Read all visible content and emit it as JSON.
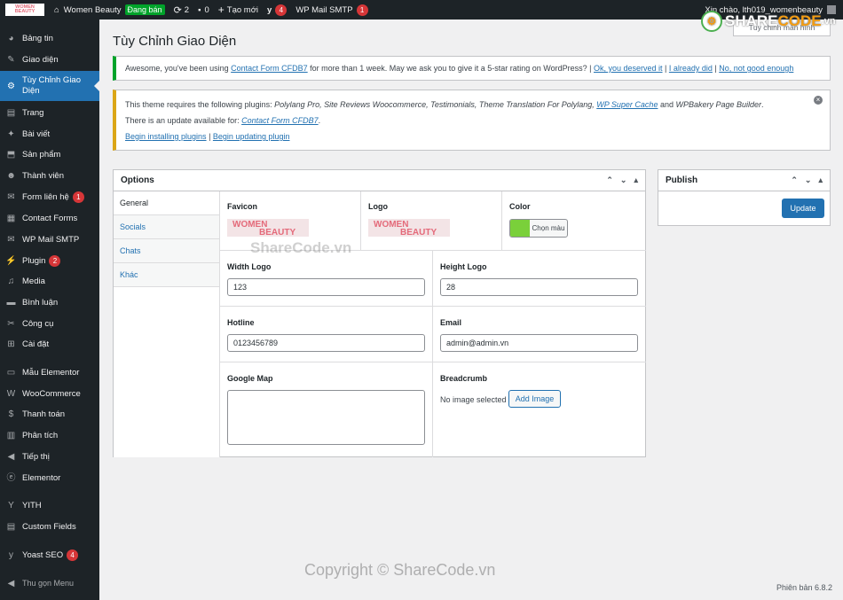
{
  "adminbar": {
    "logo_text": "WOMEN BEAUTY",
    "site_name": "Women Beauty",
    "status_badge": "Đang bán",
    "updates_count": "2",
    "comments_count": "0",
    "new_label": "Tạo mới",
    "yoast_count": "4",
    "smtp_label": "WP Mail SMTP",
    "smtp_count": "1",
    "greeting": "Xin chào, lth019_womenbeauty"
  },
  "sidebar": {
    "items": [
      {
        "label": "Bảng tin",
        "icon": "dashboard-icon"
      },
      {
        "label": "Giao diện",
        "icon": "appearance-icon"
      },
      {
        "label": "Tùy Chỉnh Giao Diện",
        "icon": "gear-icon"
      },
      {
        "label": "Trang",
        "icon": "pages-icon"
      },
      {
        "label": "Bài viết",
        "icon": "pin-icon"
      },
      {
        "label": "Sản phẩm",
        "icon": "products-icon"
      },
      {
        "label": "Thành viên",
        "icon": "users-icon"
      },
      {
        "label": "Form liên hệ",
        "icon": "mail-icon",
        "badge": "1"
      },
      {
        "label": "Contact Forms",
        "icon": "forms-icon"
      },
      {
        "label": "WP Mail SMTP",
        "icon": "smtp-icon"
      },
      {
        "label": "Plugin",
        "icon": "plugin-icon",
        "badge": "2"
      },
      {
        "label": "Media",
        "icon": "media-icon"
      },
      {
        "label": "Bình luận",
        "icon": "comment-icon"
      },
      {
        "label": "Công cụ",
        "icon": "tools-icon"
      },
      {
        "label": "Cài đặt",
        "icon": "settings-icon"
      },
      {
        "label": "Mẫu Elementor",
        "icon": "folder-icon"
      },
      {
        "label": "WooCommerce",
        "icon": "woo-icon"
      },
      {
        "label": "Thanh toán",
        "icon": "payment-icon"
      },
      {
        "label": "Phân tích",
        "icon": "analytics-icon"
      },
      {
        "label": "Tiếp thị",
        "icon": "megaphone-icon"
      },
      {
        "label": "Elementor",
        "icon": "elementor-icon"
      },
      {
        "label": "YITH",
        "icon": "yith-icon"
      },
      {
        "label": "Custom Fields",
        "icon": "fields-icon"
      },
      {
        "label": "Yoast SEO",
        "icon": "yoast-icon",
        "badge": "4"
      },
      {
        "label": "Thu gọn Menu",
        "icon": "collapse-icon"
      }
    ]
  },
  "screen_options": "Tùy chỉnh màn hình",
  "page_title": "Tùy Chỉnh Giao Diện",
  "notice_rating": {
    "text_before": "Awesome, you've been using ",
    "plugin_link": "Contact Form CFDB7",
    "text_after": " for more than 1 week. May we ask you to give it a 5-star rating on WordPress? | ",
    "link_ok": "Ok, you deserved it",
    "sep1": " | ",
    "link_done": "I already did",
    "sep2": " | ",
    "link_no": "No, not good enough"
  },
  "notice_plugins": {
    "line1_before": "This theme requires the following plugins: ",
    "line1_plugins": "Polylang Pro, Site Reviews Woocommerce, Testimonials, Theme Translation For Polylang, ",
    "line1_link": "WP Super Cache",
    "line1_and": " and ",
    "line1_last": "WPBakery Page Builder",
    "line1_end": ".",
    "line2_before": "There is an update available for: ",
    "line2_link": "Contact Form CFDB7",
    "line2_end": ".",
    "link_install": "Begin installing plugins",
    "sep": " | ",
    "link_update": "Begin updating plugin"
  },
  "options_box": {
    "title": "Options",
    "tabs": [
      "General",
      "Socials",
      "Chats",
      "Khác"
    ],
    "favicon_label": "Favicon",
    "logo_label": "Logo",
    "color_label": "Color",
    "color_button": "Chọn màu",
    "color_value": "#7ad03a",
    "img_line1": "WOMEN",
    "img_line2": "BEAUTY",
    "width_logo_label": "Width Logo",
    "width_logo_value": "123",
    "height_logo_label": "Height Logo",
    "height_logo_value": "28",
    "hotline_label": "Hotline",
    "hotline_value": "0123456789",
    "email_label": "Email",
    "email_value": "admin@admin.vn",
    "gmap_label": "Google Map",
    "breadcrumb_label": "Breadcrumb",
    "no_image": "No image selected",
    "add_image": "Add Image"
  },
  "publish_box": {
    "title": "Publish",
    "update_button": "Update"
  },
  "footer_version": "Phiên bản 6.8.2",
  "watermark_top": "ShareCode.vn",
  "watermark_bottom": "Copyright © ShareCode.vn",
  "logo_sharecode": {
    "part1": "SHARE",
    "part2": "CODE",
    "part3": ".vn"
  }
}
